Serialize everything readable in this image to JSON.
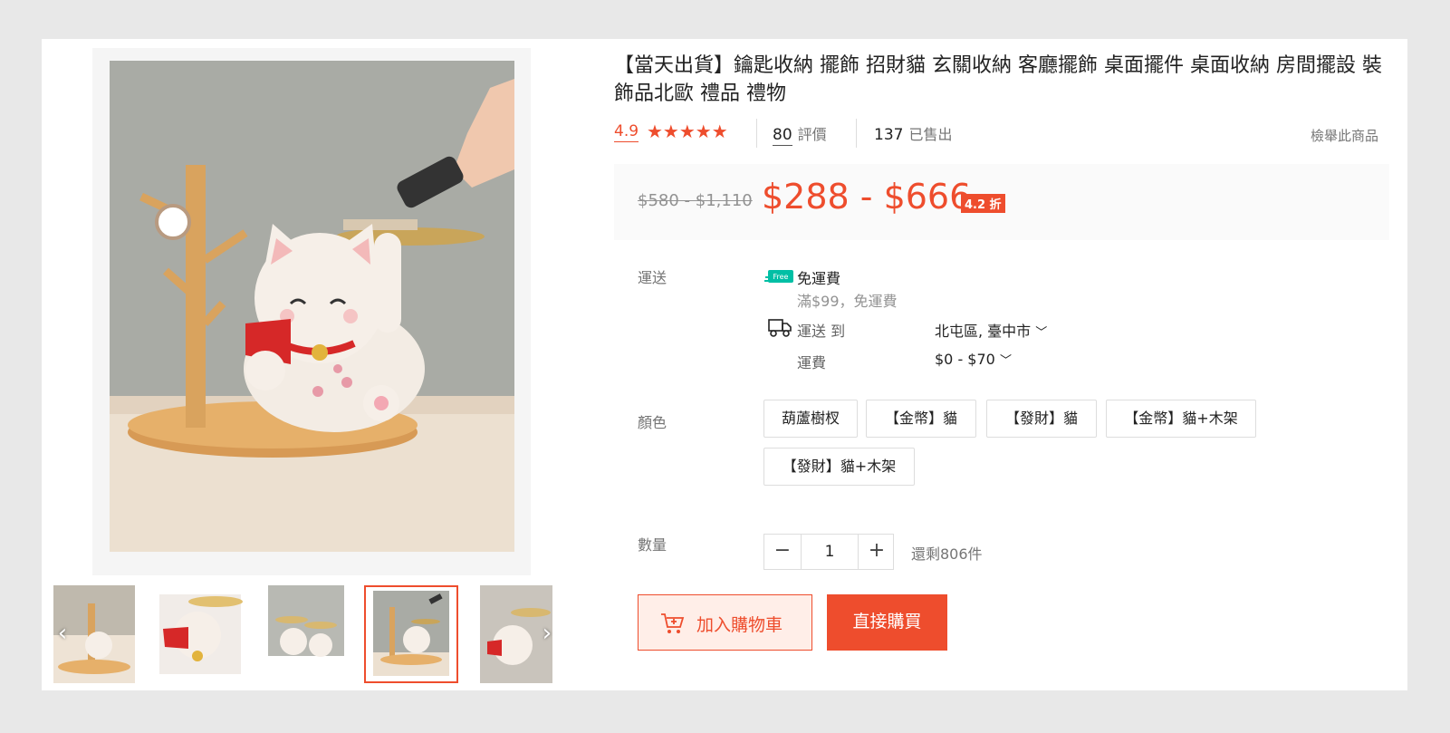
{
  "product": {
    "title": "【當天出貨】鑰匙收納 擺飾 招財貓 玄關收納 客廳擺飾 桌面擺件 桌面收納 房間擺設 裝飾品北歐 禮品 禮物",
    "rating": "4.9",
    "rating_stars": 5,
    "reviews_count": "80",
    "reviews_label": "評價",
    "sold_count": "137",
    "sold_label": "已售出",
    "report_label": "檢舉此商品"
  },
  "price": {
    "original": "$580 - $1,110",
    "current": "$288 - $666",
    "discount": "4.2 折"
  },
  "shipping": {
    "label": "運送",
    "free_icon_text": "Free",
    "free_title": "免運費",
    "free_sub": "滿$99，免運費",
    "ship_to_label": "運送 到",
    "ship_to_value": "北屯區, 臺中市",
    "fee_label": "運費",
    "fee_value": "$0 - $70"
  },
  "variants": {
    "label": "顏色",
    "options": [
      "葫蘆樹杈",
      "【金幣】貓",
      "【發財】貓",
      "【金幣】貓+木架",
      "【發財】貓+木架"
    ]
  },
  "quantity": {
    "label": "數量",
    "value": "1",
    "minus": "−",
    "plus": "+",
    "stock": "還剩806件"
  },
  "actions": {
    "add_to_cart": "加入購物車",
    "buy_now": "直接購買"
  },
  "gallery": {
    "prev": "‹",
    "next": "›",
    "active_index": 3
  },
  "colors": {
    "accent": "#ee4d2d",
    "free_green": "#00bfa5"
  }
}
